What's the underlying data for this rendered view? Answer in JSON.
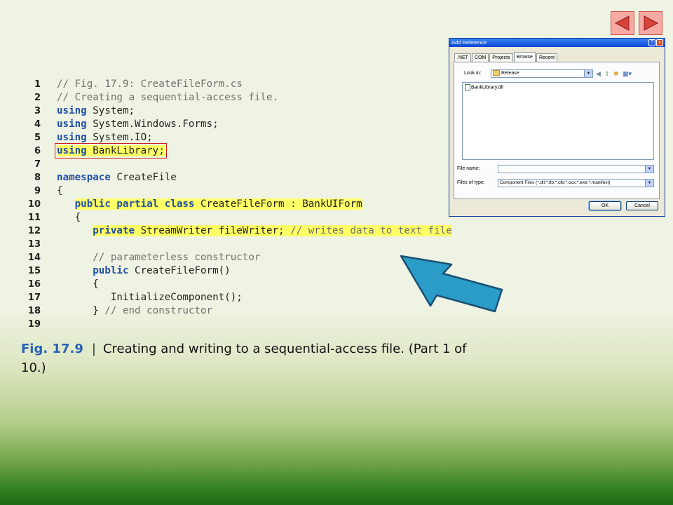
{
  "code": {
    "lines": [
      {
        "n": "1",
        "t": "// Fig. 17.9: CreateFileForm.cs"
      },
      {
        "n": "2",
        "t": "// Creating a sequential-access file."
      },
      {
        "n": "3",
        "kw": "using",
        "t": " System;"
      },
      {
        "n": "4",
        "kw": "using",
        "t": " System.Windows.Forms;"
      },
      {
        "n": "5",
        "kw": "using",
        "t": " System.IO;"
      },
      {
        "n": "6",
        "kw": "using",
        "t": " BankLibrary;"
      },
      {
        "n": "7",
        "t": ""
      },
      {
        "n": "8",
        "kw": "namespace",
        "t": " CreateFile"
      },
      {
        "n": "9",
        "t": "{"
      },
      {
        "n": "10",
        "indent": "   ",
        "kw": "public partial class",
        "t": " CreateFileForm : BankUIForm"
      },
      {
        "n": "11",
        "indent": "   ",
        "t": "{"
      },
      {
        "n": "12",
        "indent": "      ",
        "kw": "private",
        "t": " StreamWriter fileWriter; ",
        "cm": "// writes data to text file"
      },
      {
        "n": "13",
        "t": ""
      },
      {
        "n": "14",
        "indent": "      ",
        "t": "",
        "cm": "// parameterless constructor"
      },
      {
        "n": "15",
        "indent": "      ",
        "kw": "public",
        "t": " CreateFileForm()"
      },
      {
        "n": "16",
        "indent": "      ",
        "t": "{"
      },
      {
        "n": "17",
        "indent": "         ",
        "t": "InitializeComponent();"
      },
      {
        "n": "18",
        "indent": "      ",
        "t": "} ",
        "cm": "// end constructor"
      },
      {
        "n": "19",
        "t": ""
      }
    ]
  },
  "caption": {
    "label": "Fig. 17.9",
    "separator": "|",
    "text": "Creating and writing to a sequential-access file. (Part 1 of 10.)"
  },
  "dialog": {
    "title": "Add Reference",
    "help": "?",
    "close": "x",
    "tabs": [
      ".NET",
      "COM",
      "Projects",
      "Browse",
      "Recent"
    ],
    "look_in_label": "Look in:",
    "look_in_value": "Release",
    "files": [
      "BankLibrary.dll"
    ],
    "file_name_label": "File name:",
    "file_name_value": "",
    "files_of_type_label": "Files of type:",
    "files_of_type_value": "Component Files (*.dll;*.tlb;*.olb;*.ocx;*.exe;*.manifest)",
    "ok": "OK",
    "cancel": "Cancel"
  },
  "colors": {
    "keyword": "#1f4fa8",
    "comment": "#6f6f6f",
    "highlight": "#ffff66",
    "caption_label": "#2a62b8",
    "arrow": "#2b9cc8",
    "nav_button": "#f7a9a4"
  },
  "icons": {
    "nav_prev": "triangle-left-icon",
    "nav_next": "triangle-right-icon",
    "pointer": "arrow-icon"
  }
}
